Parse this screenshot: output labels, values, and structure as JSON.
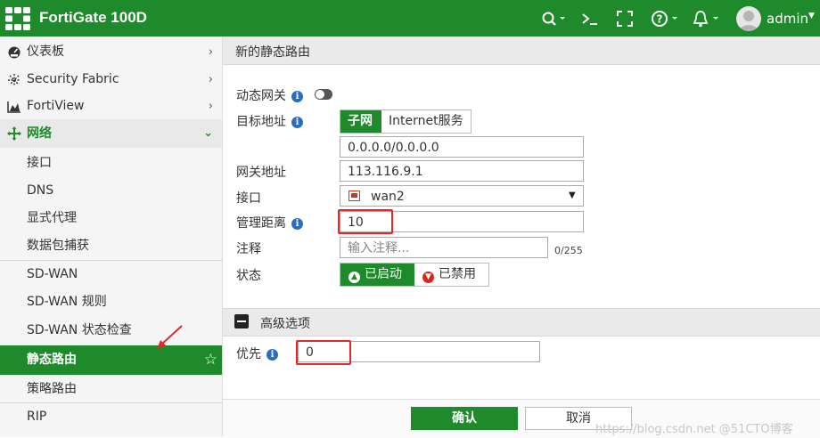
{
  "app": {
    "title": "FortiGate 100D",
    "user": "admin"
  },
  "sidebar": {
    "items": [
      {
        "label": "仪表板",
        "icon": "dashboard-icon"
      },
      {
        "label": "Security Fabric",
        "icon": "fabric-icon"
      },
      {
        "label": "FortiView",
        "icon": "chart-icon"
      },
      {
        "label": "网络",
        "icon": "network-icon"
      }
    ],
    "network_sub": [
      {
        "label": "接口"
      },
      {
        "label": "DNS"
      },
      {
        "label": "显式代理"
      },
      {
        "label": "数据包捕获"
      },
      {
        "label": "SD-WAN"
      },
      {
        "label": "SD-WAN 规则"
      },
      {
        "label": "SD-WAN 状态检查"
      },
      {
        "label": "静态路由"
      },
      {
        "label": "策略路由"
      },
      {
        "label": "RIP"
      }
    ]
  },
  "form": {
    "title": "新的静态路由",
    "dynamic_gateway_label": "动态网关",
    "destination_label": "目标地址",
    "dest_tabs": [
      "子网",
      "Internet服务"
    ],
    "destination_value": "0.0.0.0/0.0.0.0",
    "gateway_label": "网关地址",
    "gateway_value": "113.116.9.1",
    "interface_label": "接口",
    "interface_value": "wan2",
    "distance_label": "管理距离",
    "distance_value": "10",
    "comment_label": "注释",
    "comment_placeholder": "输入注释...",
    "comment_counter": "0/255",
    "status_label": "状态",
    "status_enabled": "已启动",
    "status_disabled": "已禁用",
    "advanced_label": "高级选项",
    "priority_label": "优先",
    "priority_value": "0",
    "ok_label": "确认",
    "cancel_label": "取消",
    "watermark": "https://blog.csdn.net @51CTO博客"
  },
  "colors": {
    "brand_green": "#1e8a2b",
    "highlight_red": "#e0292b",
    "info_blue": "#2a6ebd"
  }
}
